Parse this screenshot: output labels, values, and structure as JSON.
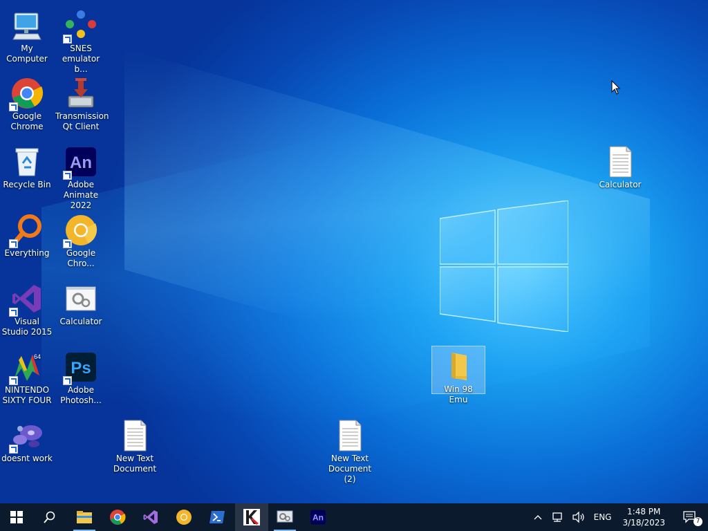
{
  "desktop": {
    "icons": [
      {
        "label": "My Computer"
      },
      {
        "label": "SNES emulator b..."
      },
      {
        "label": "Google Chrome"
      },
      {
        "label": "Transmission Qt Client"
      },
      {
        "label": "Recycle Bin"
      },
      {
        "label": "Adobe Animate 2022"
      },
      {
        "label": "Everything"
      },
      {
        "label": "Google Chro..."
      },
      {
        "label": "Visual Studio 2015"
      },
      {
        "label": "Calculator"
      },
      {
        "label": "NINTENDO SIXTY FOUR"
      },
      {
        "label": "Adobe Photosh..."
      },
      {
        "label": "doesnt work"
      },
      {
        "label": "New Text Document"
      },
      {
        "label": "New Text Document (2)"
      },
      {
        "label": "Win 98 Emu"
      },
      {
        "label": "Calculator"
      }
    ]
  },
  "taskbar": {
    "pinned": [
      {
        "icon": "windows-start-icon"
      },
      {
        "icon": "search-icon"
      },
      {
        "icon": "file-explorer-icon"
      },
      {
        "icon": "chrome-icon"
      },
      {
        "icon": "visual-studio-icon"
      },
      {
        "icon": "chrome-canary-icon"
      },
      {
        "icon": "powershell-icon"
      },
      {
        "icon": "kaspersky-icon"
      },
      {
        "icon": "network-tool-icon"
      },
      {
        "icon": "adobe-animate-icon"
      }
    ],
    "tray": {
      "language": "ENG",
      "time": "1:48 PM",
      "date": "3/18/2023",
      "notification_count": "7"
    }
  }
}
